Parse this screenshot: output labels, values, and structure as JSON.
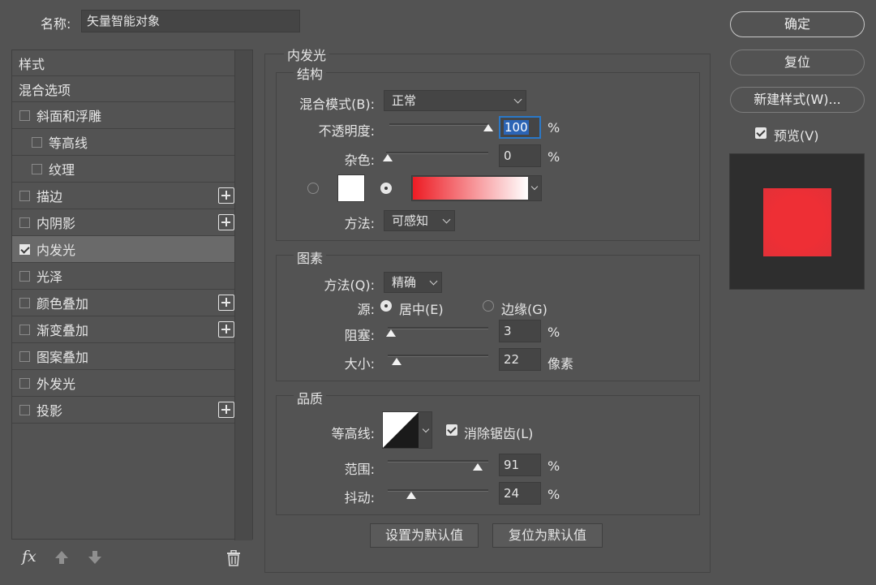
{
  "header": {
    "name_label": "名称:",
    "name_value": "矢量智能对象"
  },
  "styles": {
    "items": [
      {
        "label": "样式"
      },
      {
        "label": "混合选项"
      },
      {
        "label": "斜面和浮雕"
      },
      {
        "label": "等高线"
      },
      {
        "label": "纹理"
      },
      {
        "label": "描边"
      },
      {
        "label": "内阴影"
      },
      {
        "label": "内发光",
        "checked": true
      },
      {
        "label": "光泽"
      },
      {
        "label": "颜色叠加"
      },
      {
        "label": "渐变叠加"
      },
      {
        "label": "图案叠加"
      },
      {
        "label": "外发光"
      },
      {
        "label": "投影"
      }
    ],
    "fx_label": "fx"
  },
  "panel": {
    "title": "内发光",
    "structure": {
      "title": "结构",
      "blend_mode_label": "混合模式(B):",
      "blend_mode_value": "正常",
      "opacity_label": "不透明度:",
      "opacity_value": "100",
      "opacity_unit": "%",
      "opacity_fraction": 1.0,
      "noise_label": "杂色:",
      "noise_value": "0",
      "noise_unit": "%",
      "noise_fraction": 0.0,
      "method_label": "方法:",
      "method_value": "可感知",
      "gradient_colors": [
        "#ed1c24",
        "#ffffff"
      ]
    },
    "elements": {
      "title": "图素",
      "method_label": "方法(Q):",
      "method_value": "精确",
      "source_label": "源:",
      "center_label": "居中(E)",
      "edge_label": "边缘(G)",
      "choke_label": "阻塞:",
      "choke_value": "3",
      "choke_unit": "%",
      "choke_fraction": 0.03,
      "size_label": "大小:",
      "size_value": "22",
      "size_unit": "像素",
      "size_fraction": 0.09
    },
    "quality": {
      "title": "品质",
      "contour_label": "等高线:",
      "antialias_label": "消除锯齿(L)",
      "range_label": "范围:",
      "range_value": "91",
      "range_unit": "%",
      "range_fraction": 0.91,
      "jitter_label": "抖动:",
      "jitter_value": "24",
      "jitter_unit": "%",
      "jitter_fraction": 0.24
    },
    "set_default_label": "设置为默认值",
    "reset_default_label": "复位为默认值"
  },
  "actions": {
    "ok_label": "确定",
    "reset_label": "复位",
    "new_style_label": "新建样式(W)...",
    "preview_label": "预览(V)"
  },
  "colors": {
    "preview_swatch": "#ee2f35",
    "white_swatch": "#ffffff"
  }
}
